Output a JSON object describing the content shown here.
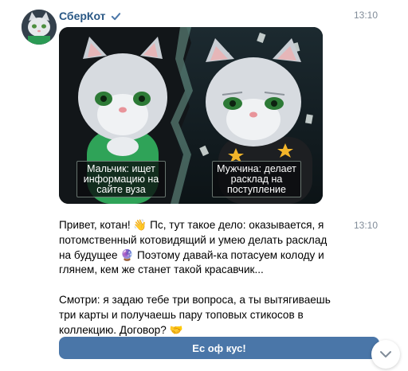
{
  "sender": {
    "name": "СберКот",
    "verified_icon": "verified-check-icon"
  },
  "times": {
    "first": "13:10",
    "second": "13:10"
  },
  "card": {
    "caption_left": "Мальчик: ищет информацию на сайте вуза",
    "caption_right": "Мужчина: делает расклад на поступление"
  },
  "message": {
    "paragraph1": "Привет, котан! 👋 Пс, тут такое дело: оказывается, я потомственный котовидящий и умею делать расклад на будущее 🔮 Поэтому давай-ка потасуем колоду и глянем, кем же станет такой красавчик...",
    "paragraph2": "Смотри: я задаю тебе три вопроса, а ты вытягиваешь три карты и получаешь пару топовых стикосов в коллекцию. Договор? 🤝"
  },
  "button": {
    "label": "Ес оф кус!"
  },
  "colors": {
    "accent": "#4a76a8",
    "name": "#2a5885",
    "meta": "#818c99"
  }
}
